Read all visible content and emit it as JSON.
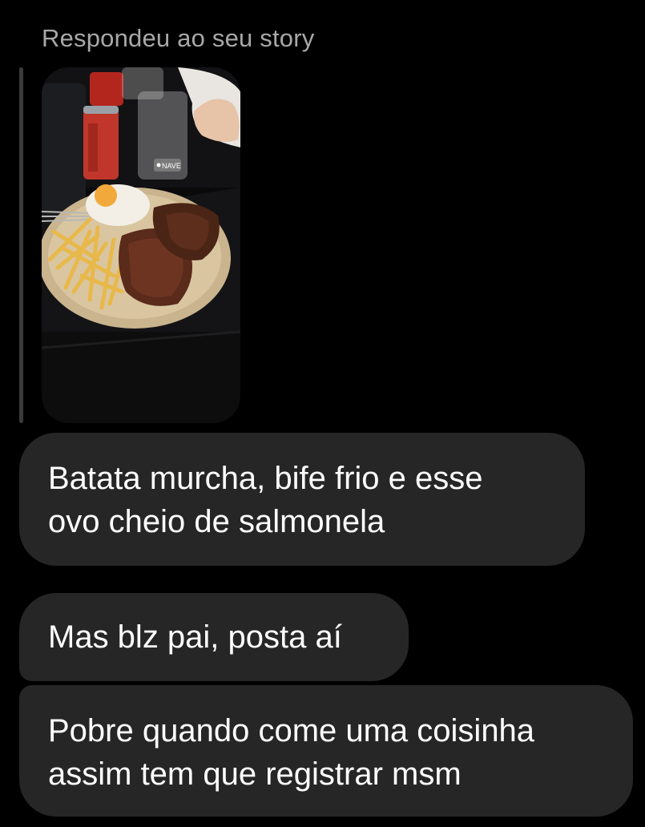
{
  "reply_header": {
    "label": "Respondeu ao seu story"
  },
  "story": {
    "location_sticker": "NAVE"
  },
  "messages": [
    {
      "text": "Batata murcha, bife frio e esse\novo cheio de salmonela"
    },
    {
      "text": "Mas blz pai, posta aí"
    },
    {
      "text": "Pobre quando come uma coisinha\nassim tem que registrar msm"
    }
  ],
  "colors": {
    "background": "#000000",
    "bubble": "#262626",
    "muted_text": "#a8a8a8",
    "reply_bar": "#3a3a3a"
  }
}
